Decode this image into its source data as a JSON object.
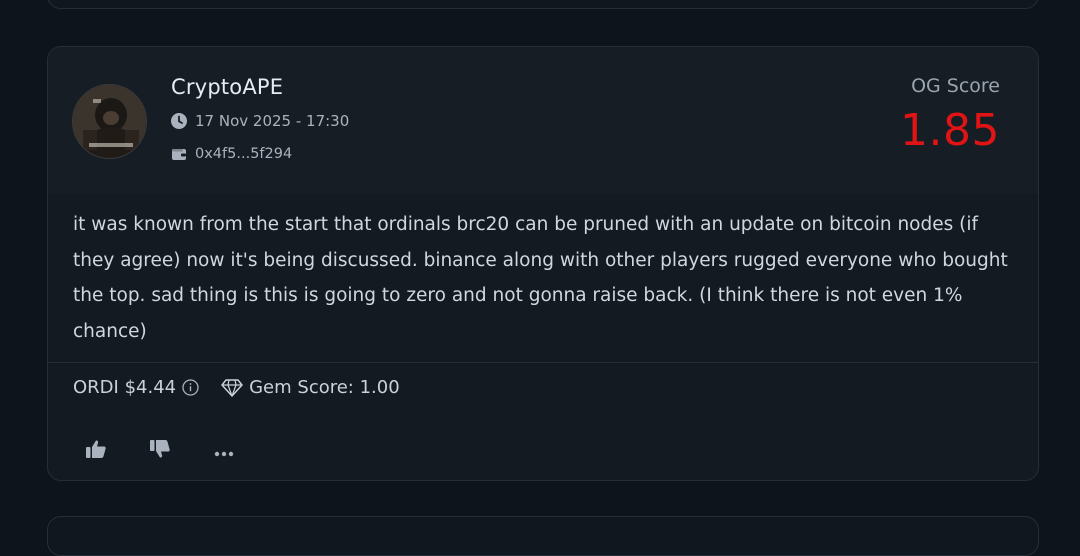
{
  "post": {
    "username": "CryptoAPE",
    "date": "17 Nov 2025 - 17:30",
    "wallet": "0x4f5...5f294",
    "og_label": "OG Score",
    "og_value": "1.85",
    "body": "it was known from the start that ordinals brc20 can be pruned with an update on bitcoin nodes (if they agree) now it's being discussed. binance along with other players rugged everyone who bought the top. sad thing is this is going to zero and not gonna raise back. (I think there is not even 1% chance)",
    "token": "ORDI $4.44",
    "gem_score": "Gem Score: 1.00"
  },
  "colors": {
    "og_value": "#e01414",
    "background": "#0e141b",
    "card": "#131a22"
  },
  "icons": {
    "date": "clock-icon",
    "wallet": "wallet-icon",
    "info": "info-icon",
    "gem": "diamond-icon",
    "like": "thumbs-up-icon",
    "dislike": "thumbs-down-icon",
    "more": "more-icon"
  }
}
